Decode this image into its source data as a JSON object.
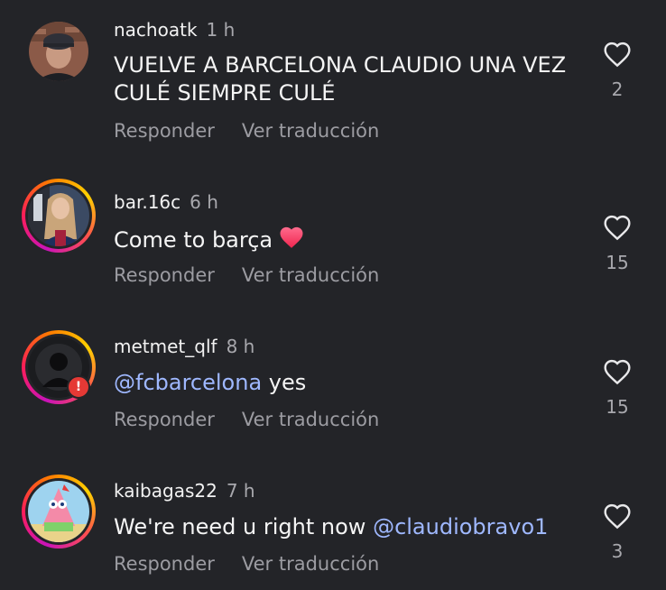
{
  "comments": [
    {
      "username": "nachoatk",
      "time": "1 h",
      "text": "VUELVE A BARCELONA CLAUDIO UNA VEZ CULÉ SIEMPRE CULÉ",
      "reply_label": "Responder",
      "translate_label": "Ver traducción",
      "likes": "2"
    },
    {
      "username": "bar.16c",
      "time": "6 h",
      "text": "Come to barça",
      "emoji": "red-heart",
      "reply_label": "Responder",
      "translate_label": "Ver traducción",
      "likes": "15"
    },
    {
      "username": "metmet_qlf",
      "time": "8 h",
      "mention": "@fcbarcelona",
      "text_after": "yes",
      "reply_label": "Responder",
      "translate_label": "Ver traducción",
      "likes": "15"
    },
    {
      "username": "kaibagas22",
      "time": "7 h",
      "text_before": "We're need u right now",
      "mention": "@claudiobravo1",
      "reply_label": "Responder",
      "translate_label": "Ver traducción",
      "likes": "3"
    }
  ],
  "colors": {
    "background": "#232428",
    "mention": "#9fb8ff",
    "muted": "#9c9ca2",
    "heart_emoji": "#ff3b6b"
  },
  "icons": {
    "like": "heart-outline-icon",
    "alert": "alert-badge-icon"
  }
}
